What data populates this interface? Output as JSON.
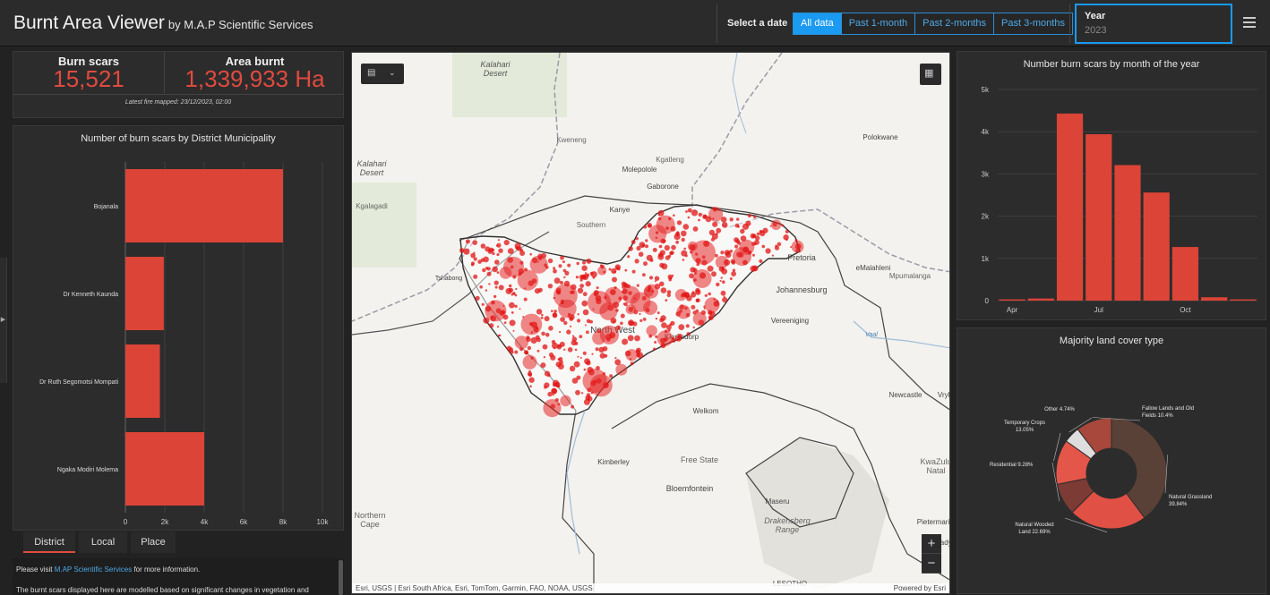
{
  "header": {
    "title": "Burnt Area Viewer",
    "subtitle": "by M.A.P Scientific Services",
    "select_label": "Select a date",
    "date_buttons": [
      "All data",
      "Past 1-month",
      "Past 2-months",
      "Past 3-months"
    ],
    "active_date": "All data",
    "year_label": "Year",
    "year_value": "2023",
    "menu_icon": "hamburger-menu-icon"
  },
  "kpis": {
    "burn_scars_label": "Burn scars",
    "burn_scars_value": "15,521",
    "area_label": "Area burnt",
    "area_value": "1,339,933 Ha",
    "latest": "Latest fire mapped: 23/12/2023, 02:00"
  },
  "colors": {
    "accent": "#e04a3f",
    "bar": "#db4437",
    "link": "#4ea9e8",
    "active_button": "#1a9af0"
  },
  "tabs": [
    "District",
    "Local",
    "Place"
  ],
  "active_tab": "District",
  "info": {
    "prefix": "Please visit ",
    "link": "M.AP Scientific Services",
    "suffix": " for more information.",
    "more": "The burnt scars displayed here are modelled based on significant changes in vegetation and"
  },
  "map": {
    "attribution": "Esri, USGS | Esri South Africa, Esri, TomTom, Garmin, FAO, NOAA, USGS",
    "powered": "Powered by Esri",
    "zoom_in": "+",
    "zoom_out": "−",
    "labels": [
      {
        "text": "Kalahari Desert",
        "lines": [
          "Kalahari",
          "Desert"
        ]
      },
      {
        "text": "Kalahari Desert (west)",
        "lines": [
          "Kalahari",
          "Desert"
        ]
      },
      {
        "text": "Kweneng"
      },
      {
        "text": "Kgatleng"
      },
      {
        "text": "Molepolole"
      },
      {
        "text": "Gaborone"
      },
      {
        "text": "Kgalagadi"
      },
      {
        "text": "Kanye"
      },
      {
        "text": "Southern"
      },
      {
        "text": "Polokwane"
      },
      {
        "text": "Tshabong"
      },
      {
        "text": "Pretoria"
      },
      {
        "text": "eMalahleni"
      },
      {
        "text": "Mpumalanga"
      },
      {
        "text": "Johannesburg"
      },
      {
        "text": "Vereeniging"
      },
      {
        "text": "North West"
      },
      {
        "text": "Klerksdorp"
      },
      {
        "text": "Vaal"
      },
      {
        "text": "Newcastle"
      },
      {
        "text": "Vryh"
      },
      {
        "text": "Welkom"
      },
      {
        "text": "Kimberley"
      },
      {
        "text": "Free State"
      },
      {
        "text": "Bloemfontein"
      },
      {
        "text": "Maseru"
      },
      {
        "text": "Northern Cape",
        "lines": [
          "Northern",
          "Cape"
        ]
      },
      {
        "text": "KwaZulu-Natal",
        "lines": [
          "KwaZulu",
          "Natal"
        ]
      },
      {
        "text": "Drakensberg Range",
        "lines": [
          "Drakensberg",
          "Range"
        ]
      },
      {
        "text": "Pietermari"
      },
      {
        "text": "LESOTHO"
      },
      {
        "text": "Lady"
      }
    ]
  },
  "chart_data": [
    {
      "type": "bar",
      "orientation": "horizontal",
      "title": "Number of burn scars by District Municipality",
      "categories": [
        "Bojanala",
        "Dr Kenneth Kaunda",
        "Dr Ruth Segomotsi Mompati",
        "Ngaka Modiri Molema"
      ],
      "values": [
        8000,
        1950,
        1750,
        4000
      ],
      "xlim": [
        0,
        10000
      ],
      "ticks": [
        0,
        2000,
        4000,
        6000,
        8000,
        10000
      ],
      "tick_labels": [
        "0",
        "2k",
        "4k",
        "6k",
        "8k",
        "10k"
      ],
      "grid": true
    },
    {
      "type": "bar",
      "title": "Number burn scars by month of the year",
      "categories": [
        "Apr",
        "May",
        "Jun",
        "Jul",
        "Aug",
        "Sep",
        "Oct",
        "Nov",
        "Dec"
      ],
      "values": [
        30,
        50,
        4430,
        3940,
        3210,
        2560,
        1270,
        80,
        30
      ],
      "ylim": [
        0,
        5000
      ],
      "y_ticks": [
        0,
        1000,
        2000,
        3000,
        4000,
        5000
      ],
      "y_tick_labels": [
        "0",
        "1k",
        "2k",
        "3k",
        "4k",
        "5k"
      ],
      "x_tick_labels": [
        "Apr",
        "Jul",
        "Oct"
      ],
      "grid": true
    },
    {
      "type": "pie",
      "donut": true,
      "title": "Majority land cover type",
      "slices": [
        {
          "name": "Natural Grassland",
          "label": "Natural Grassland 39.84%",
          "lines": [
            "Natural Grassland",
            "39.84%"
          ],
          "value": 39.84,
          "color": "#5a4138"
        },
        {
          "name": "Natural Wooded Land",
          "label": "Natural Wooded Land 22.69%",
          "lines": [
            "Natural Wooded",
            "Land 22.69%"
          ],
          "value": 22.69,
          "color": "#e05045"
        },
        {
          "name": "Residential",
          "label": "Residential 9.28%",
          "lines": [
            "Residential 9.28%"
          ],
          "value": 9.28,
          "color": "#7c3b34"
        },
        {
          "name": "Temporary Crops",
          "label": "Temporary Crops 13.05%",
          "lines": [
            "Temporary Crops",
            "13.05%"
          ],
          "value": 13.05,
          "color": "#e4564a"
        },
        {
          "name": "Other",
          "label": "Other 4.74%",
          "lines": [
            "Other 4.74%"
          ],
          "value": 4.74,
          "color": "#dedede"
        },
        {
          "name": "Fallow Lands and Old Fields",
          "label": "Fallow Lands and Old Fields 10.4%",
          "lines": [
            "Fallow Lands and Old",
            "Fields 10.4%"
          ],
          "value": 10.4,
          "color": "#a8473c"
        }
      ]
    }
  ]
}
